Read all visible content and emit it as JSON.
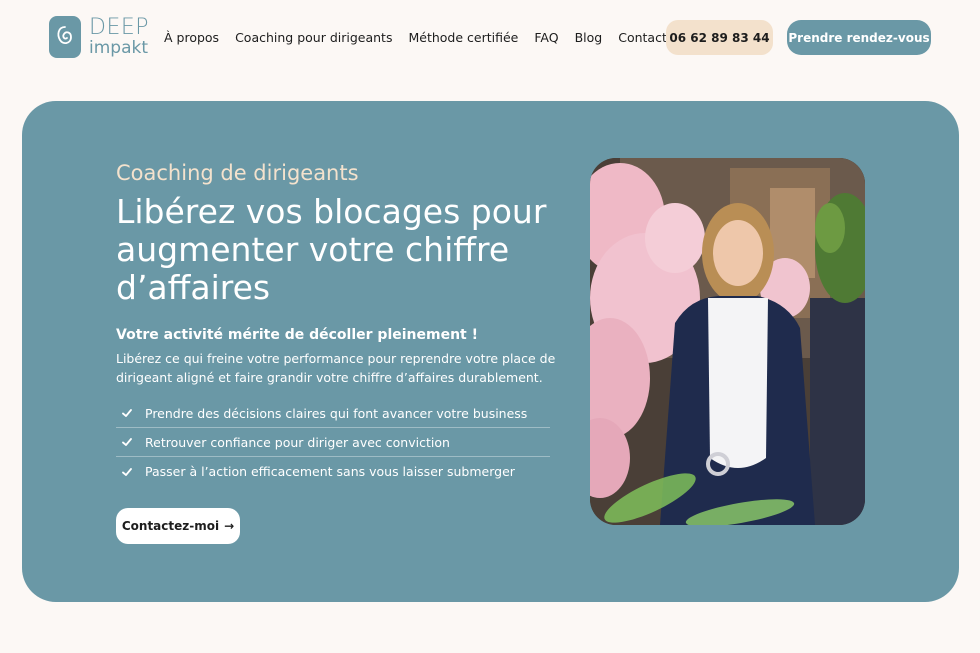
{
  "header": {
    "logo": {
      "line1": "DEEP",
      "line2": "impakt"
    },
    "nav": [
      "À propos",
      "Coaching pour dirigeants",
      "Méthode certifiée",
      "FAQ",
      "Blog",
      "Contact"
    ],
    "phone": "06 62 89 83 44",
    "cta": "Prendre rendez-vous"
  },
  "hero": {
    "eyebrow": "Coaching de dirigeants",
    "headline": "Libérez vos blocages pour augmenter votre chiffre d’affaires",
    "subhead": "Votre activité mérite de décoller pleinement !",
    "paragraph": "Libérez ce qui freine votre performance pour reprendre votre place de dirigeant aligné et faire grandir votre chiffre d’affaires durablement.",
    "checklist": [
      "Prendre des décisions claires qui font avancer votre business",
      "Retrouver confiance pour diriger avec conviction",
      "Passer à l’action efficacement sans vous laisser submerger"
    ],
    "cta": "Contactez-moi"
  },
  "colors": {
    "background": "#fcf8f5",
    "accent": "#6a98a6",
    "sand": "#f3e1cc",
    "eyebrow": "#f4e2cd"
  }
}
